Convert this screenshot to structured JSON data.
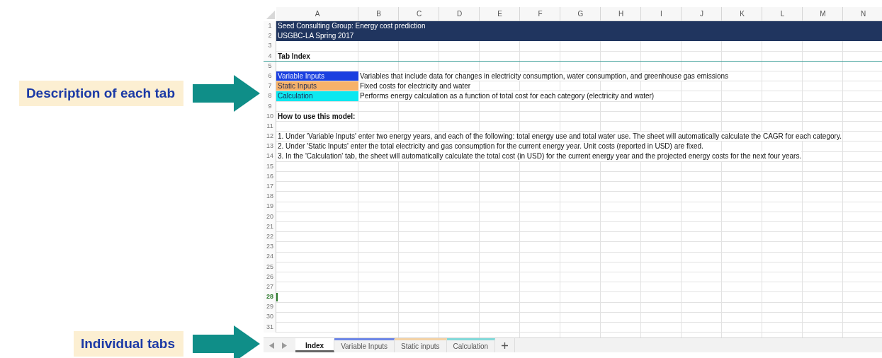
{
  "callouts": [
    {
      "text": "Description of each tab"
    },
    {
      "text": "Individual tabs"
    }
  ],
  "sheet": {
    "columns": [
      "A",
      "B",
      "C",
      "D",
      "E",
      "F",
      "G",
      "H",
      "I",
      "J",
      "K",
      "L",
      "M",
      "N"
    ],
    "rows": [
      {
        "number": "1",
        "kind": "banner",
        "selected": false,
        "cells": [
          {
            "text": "Seed Consulting Group: Energy cost prediction",
            "bold": false
          }
        ]
      },
      {
        "number": "2",
        "kind": "banner",
        "selected": false,
        "cells": [
          {
            "text": "USGBC-LA Spring 2017",
            "bold": false
          }
        ]
      },
      {
        "number": "3",
        "kind": "plain",
        "selected": false,
        "cells": []
      },
      {
        "number": "4",
        "kind": "rule",
        "selected": false,
        "cells": [
          {
            "text": "Tab Index",
            "bold": true
          }
        ]
      },
      {
        "number": "5",
        "kind": "plain",
        "selected": false,
        "cells": []
      },
      {
        "number": "6",
        "kind": "plain",
        "selected": false,
        "cells": [
          {
            "text": "Variable Inputs",
            "bold": false,
            "color": "#1a3fe0"
          },
          {
            "text": "Variables that include data for changes in electricity consumption, water consumption, and greenhouse gas emissions",
            "bold": false
          }
        ]
      },
      {
        "number": "7",
        "kind": "plain",
        "selected": false,
        "cells": [
          {
            "text": "Static Inputs",
            "bold": false,
            "color": "#f7b26a"
          },
          {
            "text": "Fixed costs for electricity and water",
            "bold": false
          }
        ]
      },
      {
        "number": "8",
        "kind": "plain",
        "selected": false,
        "cells": [
          {
            "text": "Calculation",
            "bold": false,
            "color": "#0ce8f0"
          },
          {
            "text": "Performs energy calculation as a function of total cost for each category (electricity and water)",
            "bold": false
          }
        ]
      },
      {
        "number": "9",
        "kind": "plain",
        "selected": false,
        "cells": []
      },
      {
        "number": "10",
        "kind": "plain",
        "selected": false,
        "cells": [
          {
            "text": "How to use this model:",
            "bold": true
          }
        ]
      },
      {
        "number": "11",
        "kind": "plain",
        "selected": false,
        "cells": []
      },
      {
        "number": "12",
        "kind": "plain",
        "selected": false,
        "cells": [
          {
            "text": "1. Under 'Variable Inputs' enter two energy years, and each of the following: total energy use and total water use. The sheet will automatically calculate the CAGR for each category.",
            "bold": false
          }
        ]
      },
      {
        "number": "13",
        "kind": "plain",
        "selected": false,
        "cells": [
          {
            "text": "2. Under 'Static Inputs' enter the total electricity and gas consumption for the current energy year. Unit costs (reported in USD) are fixed.",
            "bold": false
          }
        ]
      },
      {
        "number": "14",
        "kind": "plain",
        "selected": false,
        "cells": [
          {
            "text": "3. In the 'Calculation' tab, the sheet will automatically calculate the total cost (in USD) for the current energy year and the projected energy costs for the next four years.",
            "bold": false
          }
        ]
      },
      {
        "number": "15",
        "kind": "plain",
        "selected": false,
        "cells": []
      },
      {
        "number": "16",
        "kind": "plain",
        "selected": false,
        "cells": []
      },
      {
        "number": "17",
        "kind": "plain",
        "selected": false,
        "cells": []
      },
      {
        "number": "18",
        "kind": "plain",
        "selected": false,
        "cells": []
      },
      {
        "number": "19",
        "kind": "plain",
        "selected": false,
        "cells": []
      },
      {
        "number": "20",
        "kind": "plain",
        "selected": false,
        "cells": []
      },
      {
        "number": "21",
        "kind": "plain",
        "selected": false,
        "cells": []
      },
      {
        "number": "22",
        "kind": "plain",
        "selected": false,
        "cells": []
      },
      {
        "number": "23",
        "kind": "plain",
        "selected": false,
        "cells": []
      },
      {
        "number": "24",
        "kind": "plain",
        "selected": false,
        "cells": []
      },
      {
        "number": "25",
        "kind": "plain",
        "selected": false,
        "cells": []
      },
      {
        "number": "26",
        "kind": "plain",
        "selected": false,
        "cells": []
      },
      {
        "number": "27",
        "kind": "plain",
        "selected": false,
        "cells": []
      },
      {
        "number": "28",
        "kind": "plain",
        "selected": true,
        "cells": []
      },
      {
        "number": "29",
        "kind": "plain",
        "selected": false,
        "cells": []
      },
      {
        "number": "30",
        "kind": "plain",
        "selected": false,
        "cells": []
      },
      {
        "number": "31",
        "kind": "plain",
        "selected": false,
        "cells": []
      }
    ]
  },
  "tabs": [
    {
      "label": "Index",
      "selected": true
    },
    {
      "label": "Variable Inputs",
      "selected": false,
      "color": "#6d86e6"
    },
    {
      "label": "Static inputs",
      "selected": false,
      "color": "#f3d2a6"
    },
    {
      "label": "Calculation",
      "selected": false,
      "color": "#82d9d9"
    }
  ]
}
